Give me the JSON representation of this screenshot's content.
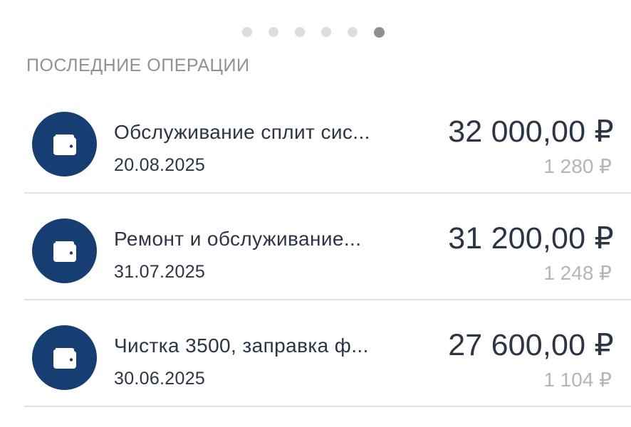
{
  "pager": {
    "count": 6,
    "active_index": 5
  },
  "section_title": "ПОСЛЕДНИЕ ОПЕРАЦИИ",
  "colors": {
    "icon_bg": "#173e72",
    "primary_text": "#2b3545",
    "secondary_text": "#b3b5b9",
    "section_title": "#8e9196"
  },
  "operations": [
    {
      "icon": "wallet-icon",
      "name": "Обслуживание сплит сис...",
      "date": "20.08.2025",
      "amount": "32 000,00 ₽",
      "cashback": "1 280 ₽"
    },
    {
      "icon": "wallet-icon",
      "name": "Ремонт и обслуживание...",
      "date": "31.07.2025",
      "amount": "31 200,00 ₽",
      "cashback": "1 248 ₽"
    },
    {
      "icon": "wallet-icon",
      "name": "Чистка 3500, заправка ф...",
      "date": "30.06.2025",
      "amount": "27 600,00 ₽",
      "cashback": "1 104 ₽"
    }
  ]
}
